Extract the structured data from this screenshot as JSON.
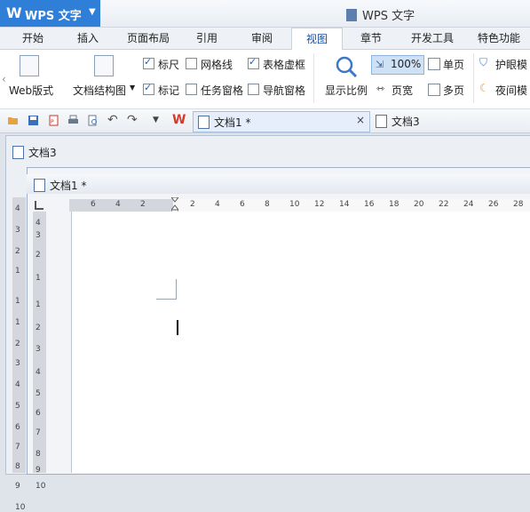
{
  "app": {
    "logo_glyph": "W",
    "menu_title": "WPS 文字",
    "window_title": "WPS 文字"
  },
  "tabs": [
    "开始",
    "插入",
    "页面布局",
    "引用",
    "审阅",
    "视图",
    "章节",
    "开发工具",
    "特色功能"
  ],
  "active_tab": "视图",
  "ribbon": {
    "web_layout": "Web版式",
    "doc_map": "文档结构图",
    "checks": [
      {
        "label": "标尺",
        "checked": true
      },
      {
        "label": "网格线",
        "checked": false
      },
      {
        "label": "表格虚框",
        "checked": true
      },
      {
        "label": "标记",
        "checked": true
      },
      {
        "label": "任务窗格",
        "checked": false
      },
      {
        "label": "导航窗格",
        "checked": false
      }
    ],
    "zoom_label": "显示比例",
    "zoom_value": "100%",
    "page_width": "页宽",
    "single_page": "单页",
    "multi_page": "多页",
    "eye_mode": "护眼模",
    "night_mode": "夜间模"
  },
  "doc_tabs": [
    {
      "title": "文档1 *"
    },
    {
      "title": "文档3"
    }
  ],
  "outer_doc_title": "文档3",
  "inner_doc_title": "文档1 *",
  "ruler_ticks": [
    "6",
    "4",
    "2",
    "2",
    "4",
    "6",
    "8",
    "10",
    "12",
    "14",
    "16",
    "18",
    "20",
    "22",
    "24",
    "26",
    "28"
  ],
  "vruler_outer": [
    "4",
    "3",
    "2",
    "1",
    "1",
    "1",
    "2",
    "3",
    "4",
    "5",
    "6",
    "7",
    "8",
    "9",
    "10"
  ],
  "vruler_inner": [
    "4",
    "3",
    "2",
    "1",
    "1",
    "2",
    "3",
    "4",
    "5",
    "6",
    "7",
    "8",
    "9",
    "10"
  ]
}
